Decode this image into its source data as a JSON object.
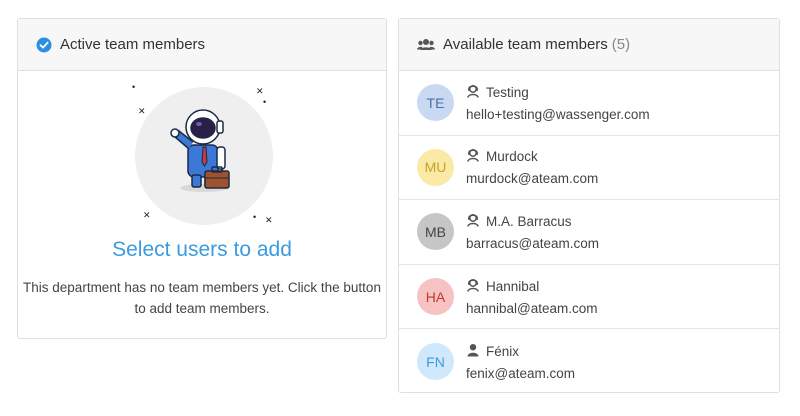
{
  "active_panel": {
    "title": "Active team members",
    "empty_title": "Select users to add",
    "empty_desc": "This department has no team members yet. Click the button to add team members."
  },
  "available_panel": {
    "title": "Available team members",
    "count": "(5)",
    "members": [
      {
        "initials": "TE",
        "name": "Testing",
        "email": "hello+testing@wassenger.com",
        "icon": "user-agent-icon",
        "bg": "#c9d9f2",
        "fg": "#4a6fa5"
      },
      {
        "initials": "MU",
        "name": "Murdock",
        "email": "murdock@ateam.com",
        "icon": "user-agent-icon",
        "bg": "#fbeaa5",
        "fg": "#c9a227"
      },
      {
        "initials": "MB",
        "name": "M.A. Barracus",
        "email": "barracus@ateam.com",
        "icon": "user-agent-icon",
        "bg": "#c6c6c6",
        "fg": "#444444"
      },
      {
        "initials": "HA",
        "name": "Hannibal",
        "email": "hannibal@ateam.com",
        "icon": "user-agent-icon",
        "bg": "#f6c2c2",
        "fg": "#c0392b"
      },
      {
        "initials": "FN",
        "name": "Fénix",
        "email": "fenix@ateam.com",
        "icon": "user-icon",
        "bg": "#cfe8fb",
        "fg": "#3a9be0"
      }
    ]
  },
  "colors": {
    "accent": "#3a9be0",
    "check": "#2d8fe0"
  }
}
